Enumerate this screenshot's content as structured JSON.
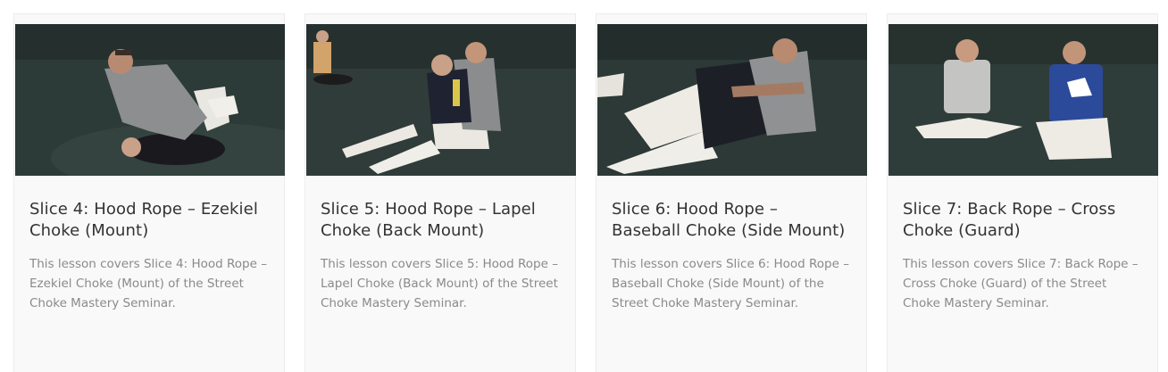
{
  "lessons": [
    {
      "title": "Slice 4: Hood Rope – Ezekiel Choke (Mount)",
      "description": "This lesson covers Slice 4: Hood Rope – Ezekiel Choke (Mount) of the Street Choke Mastery Seminar.",
      "thumbnail_alt": "Instructor in grey hoodie applying Ezekiel choke from mount on partner in black gi"
    },
    {
      "title": "Slice 5: Hood Rope – Lapel Choke (Back Mount)",
      "description": "This lesson covers Slice 5: Hood Rope – Lapel Choke (Back Mount) of the Street Choke Mastery Seminar.",
      "thumbnail_alt": "Two men seated on mat demonstrating lapel choke from back mount"
    },
    {
      "title": "Slice 6: Hood Rope – Baseball Choke (Side Mount)",
      "description": "This lesson covers Slice 6: Hood Rope – Baseball Choke (Side Mount) of the Street Choke Mastery Seminar.",
      "thumbnail_alt": "Grappler in grey hoodie controlling partner from side mount"
    },
    {
      "title": "Slice 7: Back Rope – Cross Choke (Guard)",
      "description": "This lesson covers Slice 7: Back Rope – Cross Choke (Guard) of the Street Choke Mastery Seminar.",
      "thumbnail_alt": "Two instructors sitting on mat in Gracie shirts"
    }
  ],
  "colors": {
    "card_bg": "#f9f9f9",
    "title": "#333333",
    "description": "#8a8a8a",
    "mat": "#2e3a37"
  }
}
